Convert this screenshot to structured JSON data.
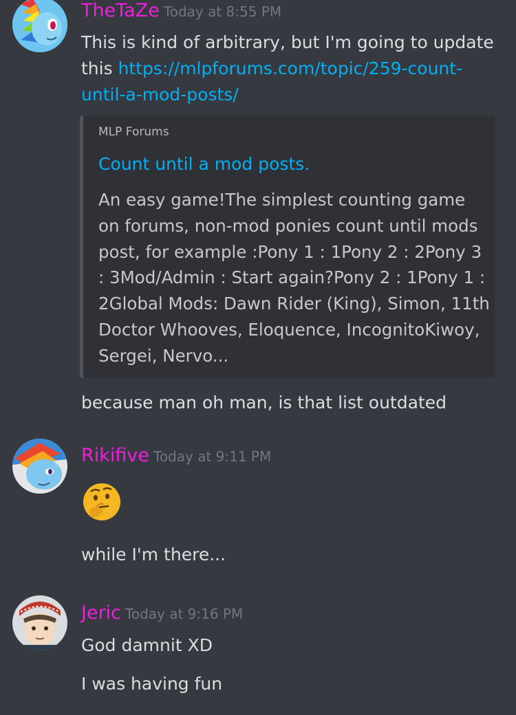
{
  "messages": [
    {
      "username": "TheTaZe",
      "timestamp": "Today at 8:55 PM",
      "avatar_icon": "rainbow-dash-pony-avatar",
      "text_before_link": "This is kind of arbitrary, but I'm going to update this ",
      "link_text": "https://mlpforums.com/topic/259-count-until-a-mod-posts/",
      "embed": {
        "provider": "MLP Forums",
        "title": "Count until a mod posts.",
        "description": "An easy game!The simplest counting game on forums, non-mod ponies count until mods post, for example :Pony 1 : 1Pony 2 : 2Pony 3 : 3Mod/Admin : Start again?Pony 2 : 1Pony 1 : 2Global Mods: Dawn Rider (King), Simon, 11th Doctor Whooves, Eloquence, IncognitoKiwoy, Sergei, Nervo..."
      },
      "followup_text": "because man oh man, is that list outdated"
    },
    {
      "username": "Rikifive",
      "timestamp": "Today at 9:11 PM",
      "avatar_icon": "pony-avatar",
      "emoji_icon": "thinking-face-emoji",
      "followup_text": "while I'm there..."
    },
    {
      "username": "Jeric",
      "timestamp": "Today at 9:16 PM",
      "avatar_icon": "anime-character-avatar",
      "text": "God damnit XD",
      "followup_text": "I was having fun"
    }
  ],
  "colors": {
    "background": "#36393f",
    "username": "#f01fdc",
    "link": "#00b0f4",
    "timestamp": "#72767d"
  }
}
